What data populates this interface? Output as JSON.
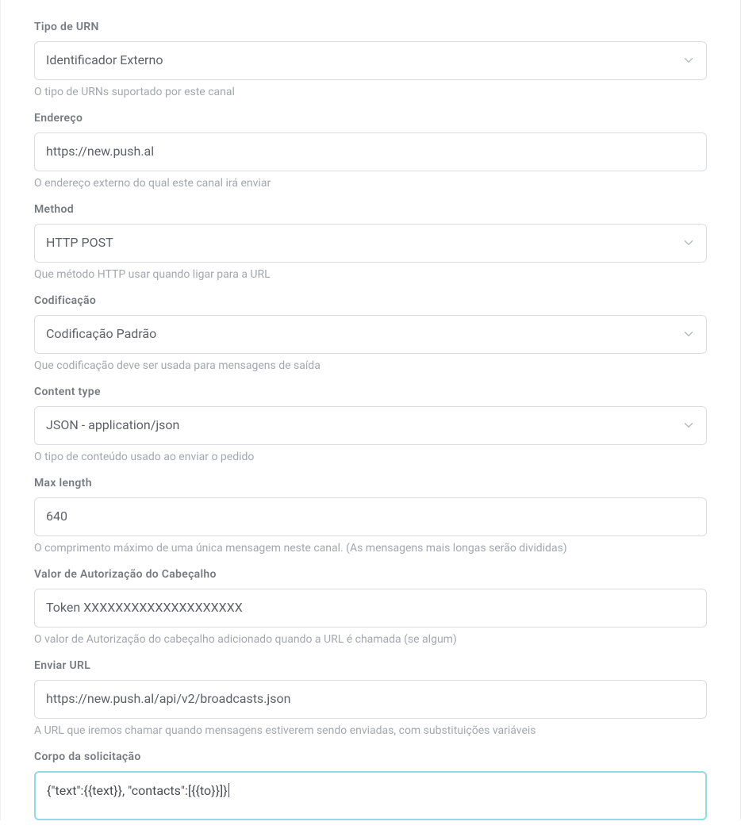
{
  "fields": {
    "urn_type": {
      "label": "Tipo de URN",
      "value": "Identificador Externo",
      "hint": "O tipo de URNs suportado por este canal"
    },
    "address": {
      "label": "Endereço",
      "value": "https://new.push.al",
      "hint": "O endereço externo do qual este canal irá enviar"
    },
    "method": {
      "label": "Method",
      "value": "HTTP POST",
      "hint": "Que método HTTP usar quando ligar para a URL"
    },
    "encoding": {
      "label": "Codificação",
      "value": "Codificação Padrão",
      "hint": "Que codificação deve ser usada para mensagens de saída"
    },
    "content_type": {
      "label": "Content type",
      "value": "JSON - application/json",
      "hint": "O tipo de conteúdo usado ao enviar o pedido"
    },
    "max_length": {
      "label": "Max length",
      "value": "640",
      "hint": "O comprimento máximo de uma única mensagem neste canal. (As mensagens mais longas serão divididas)"
    },
    "auth_header": {
      "label": "Valor de Autorização do Cabeçalho",
      "value": "Token XXXXXXXXXXXXXXXXXXXX",
      "hint": "O valor de Autorização do cabeçalho adicionado quando a URL é chamada (se algum)"
    },
    "send_url": {
      "label": "Enviar URL",
      "value": "https://new.push.al/api/v2/broadcasts.json",
      "hint": "A URL que iremos chamar quando mensagens estiverem sendo enviadas, com substituições variáveis"
    },
    "request_body": {
      "label": "Corpo da solicitação",
      "value": "{\"text\":{{text}}, \"contacts\":[{{to}}]}"
    }
  }
}
